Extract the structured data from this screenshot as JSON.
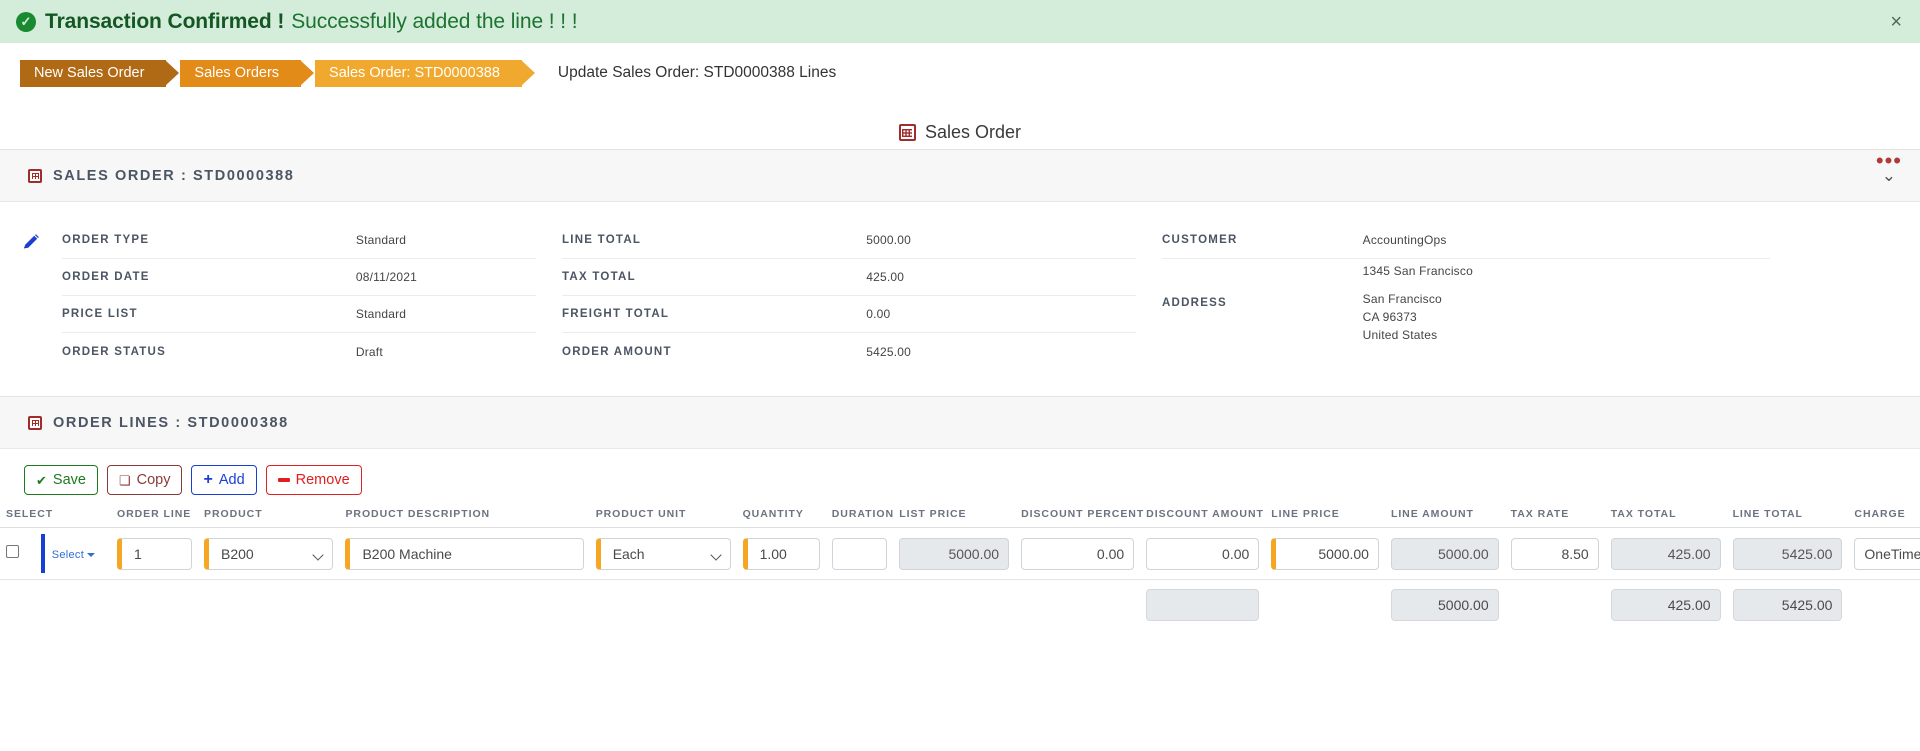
{
  "alert": {
    "icon": "check-circle-icon",
    "strong": "Transaction Confirmed !",
    "message": "Successfully added the line ! ! !",
    "close": "×"
  },
  "breadcrumb": {
    "items": [
      {
        "label": "New Sales Order"
      },
      {
        "label": "Sales Orders"
      },
      {
        "label": "Sales Order: STD0000388"
      }
    ],
    "current": "Update Sales Order: STD0000388 Lines"
  },
  "overflow_menu": "•••",
  "page": {
    "title": "Sales Order",
    "icon": "grid-icon"
  },
  "sales_order_panel": {
    "title": "SALES ORDER : STD0000388",
    "collapse_icon": "chevron-down-icon",
    "edit_icon": "pencil-icon",
    "columns": [
      {
        "rows": [
          {
            "label": "ORDER TYPE",
            "value": "Standard"
          },
          {
            "label": "ORDER DATE",
            "value": "08/11/2021"
          },
          {
            "label": "PRICE LIST",
            "value": "Standard"
          },
          {
            "label": "ORDER STATUS",
            "value": "Draft"
          }
        ]
      },
      {
        "rows": [
          {
            "label": "LINE TOTAL",
            "value": "5000.00"
          },
          {
            "label": "TAX TOTAL",
            "value": "425.00"
          },
          {
            "label": "FREIGHT TOTAL",
            "value": "0.00"
          },
          {
            "label": "ORDER AMOUNT",
            "value": "5425.00"
          }
        ]
      },
      {
        "rows": [
          {
            "label": "CUSTOMER",
            "value": "AccountingOps"
          },
          {
            "label": "ADDRESS",
            "lines": [
              "1345 San Francisco",
              "San Francisco",
              "CA 96373",
              "United States"
            ]
          }
        ]
      }
    ]
  },
  "order_lines_panel": {
    "title": "ORDER LINES : STD0000388",
    "toolbar": [
      {
        "name": "save-button",
        "label": "Save",
        "icon": "save-icon"
      },
      {
        "name": "copy-button",
        "label": "Copy",
        "icon": "copy-icon"
      },
      {
        "name": "add-button",
        "label": "Add",
        "icon": "plus-icon"
      },
      {
        "name": "remove-button",
        "label": "Remove",
        "icon": "minus-icon"
      }
    ],
    "columns": [
      "SELECT",
      "ORDER LINE",
      "PRODUCT",
      "PRODUCT DESCRIPTION",
      "PRODUCT UNIT",
      "QUANTITY",
      "DURATION",
      "LIST PRICE",
      "DISCOUNT PERCENT",
      "DISCOUNT AMOUNT",
      "LINE PRICE",
      "LINE AMOUNT",
      "TAX RATE",
      "TAX TOTAL",
      "LINE TOTAL",
      "CHARGE"
    ],
    "row": {
      "select_label": "Select",
      "order_line": "1",
      "product": "B200",
      "product_description": "B200 Machine",
      "product_unit": "Each",
      "quantity": "1.00",
      "duration": "",
      "list_price": "5000.00",
      "discount_percent": "0.00",
      "discount_amount": "0.00",
      "line_price": "5000.00",
      "line_amount": "5000.00",
      "tax_rate": "8.50",
      "tax_total": "425.00",
      "line_total": "5425.00",
      "charge": "OneTime"
    },
    "totals": {
      "discount_amount": "",
      "line_amount": "5000.00",
      "tax_total": "425.00",
      "line_total": "5425.00"
    }
  }
}
